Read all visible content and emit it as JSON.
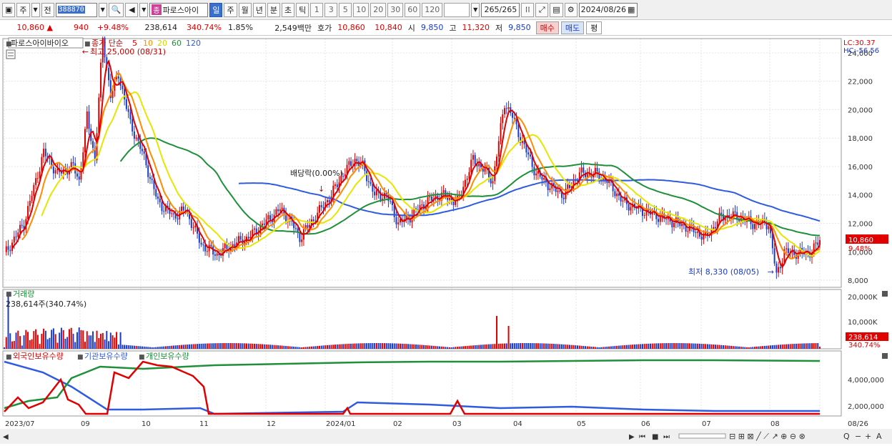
{
  "toolbar": {
    "market_label": "주",
    "prev_label": "전",
    "code": "388870",
    "stock_tag": "종",
    "stock_name": "파로스아이",
    "period_buttons": [
      "일",
      "주",
      "월",
      "년",
      "분",
      "초",
      "틱"
    ],
    "interval_buttons": [
      "1",
      "3",
      "5",
      "10",
      "20",
      "30",
      "60",
      "120"
    ],
    "count": "265/265",
    "date": "2024/08/26"
  },
  "quote": {
    "price": "10,860",
    "change": "940",
    "change_pct": "+9.48%",
    "volume": "238,614",
    "volume_ratio": "340.74%",
    "turnover": "1.85%",
    "amount": "2,549백만",
    "ask_label": "호가",
    "ask": "10,860",
    "bid": "10,840",
    "open_label": "시",
    "open": "9,850",
    "high_label": "고",
    "high": "11,320",
    "low_label": "저",
    "low": "9,850",
    "buy_label": "매수",
    "sell_label": "매도",
    "eval_label": "평"
  },
  "colors": {
    "up": "#e00000",
    "down": "#1a3cc8",
    "ma5": "#e00000",
    "ma10": "#ff8c00",
    "ma20": "#e6e600",
    "ma60": "#1f8f3a",
    "ma120": "#2f5be0"
  },
  "price_panel": {
    "stock_label": "파로스아이바이오",
    "legend_label": "종가 단순",
    "legend_periods": [
      "5",
      "10",
      "20",
      "60",
      "120"
    ],
    "max_annotation": "최고 25,000 (08/31)",
    "min_annotation": "최저 8,330 (08/05)",
    "dividend_annotation": "배당락(0.00%)",
    "lc": "LC:30.37",
    "hc": "HC:-56.56",
    "current_price": "10,860",
    "current_pct": "9.48%",
    "y_ticks": [
      "24,000",
      "22,000",
      "20,000",
      "18,000",
      "16,000",
      "14,000",
      "12,000",
      "10,000",
      "8,000"
    ]
  },
  "volume_panel": {
    "title": "거래량",
    "value": "238,614주(340.74%)",
    "current": "238,614",
    "current_pct": "340.74%",
    "y_ticks": [
      "20,000K",
      "10,000K"
    ]
  },
  "holding_panel": {
    "legends": [
      "외국인보유수량",
      "기관보유수량",
      "개인보유수량"
    ],
    "y_ticks": [
      "4,000,000",
      "2,000,000"
    ]
  },
  "x_axis": {
    "labels": [
      "2023/07",
      "09",
      "10",
      "11",
      "12",
      "2024/01",
      "02",
      "03",
      "04",
      "05",
      "06",
      "07",
      "08",
      "08/26"
    ]
  },
  "chart_data": [
    {
      "type": "line",
      "title": "파로스아이바이오",
      "ylabel": "",
      "ylim": [
        7500,
        25000
      ],
      "x": [
        "2023/07",
        "2023/08",
        "2023/08/31",
        "2023/09",
        "2023/10",
        "2023/11",
        "2023/12",
        "2024/01",
        "2024/02",
        "2024/03",
        "2024/04",
        "2024/05",
        "2024/06",
        "2024/07",
        "2024/08/05",
        "2024/08/26"
      ],
      "series": [
        {
          "name": "5",
          "values": [
            9800,
            15500,
            25000,
            20500,
            13500,
            10000,
            12000,
            15000,
            12000,
            16500,
            18500,
            15500,
            12500,
            11000,
            8330,
            10860
          ]
        },
        {
          "name": "10",
          "values": [
            10500,
            15000,
            22000,
            20000,
            14000,
            10300,
            11800,
            14500,
            12300,
            15800,
            18000,
            15700,
            12700,
            11200,
            9500,
            10300
          ]
        },
        {
          "name": "20",
          "values": [
            11000,
            14800,
            20500,
            19000,
            15000,
            10800,
            11600,
            14000,
            12800,
            15000,
            17500,
            15800,
            13000,
            11500,
            10500,
            10500
          ]
        },
        {
          "name": "60",
          "values": [
            null,
            null,
            null,
            null,
            15800,
            15000,
            13000,
            12500,
            13500,
            14000,
            15500,
            15800,
            14800,
            13000,
            12000,
            11500
          ]
        },
        {
          "name": "120",
          "values": [
            null,
            null,
            null,
            null,
            null,
            null,
            null,
            null,
            14500,
            13500,
            14000,
            14500,
            14600,
            14200,
            13800,
            13500
          ]
        }
      ]
    },
    {
      "type": "bar",
      "title": "거래량",
      "ylim": [
        0,
        22000000
      ],
      "values": [
        238614
      ]
    },
    {
      "type": "line",
      "title": "",
      "legend": [
        "외국인보유수량",
        "기관보유수량",
        "개인보유수량"
      ],
      "ylim": [
        0,
        6000000
      ]
    }
  ]
}
